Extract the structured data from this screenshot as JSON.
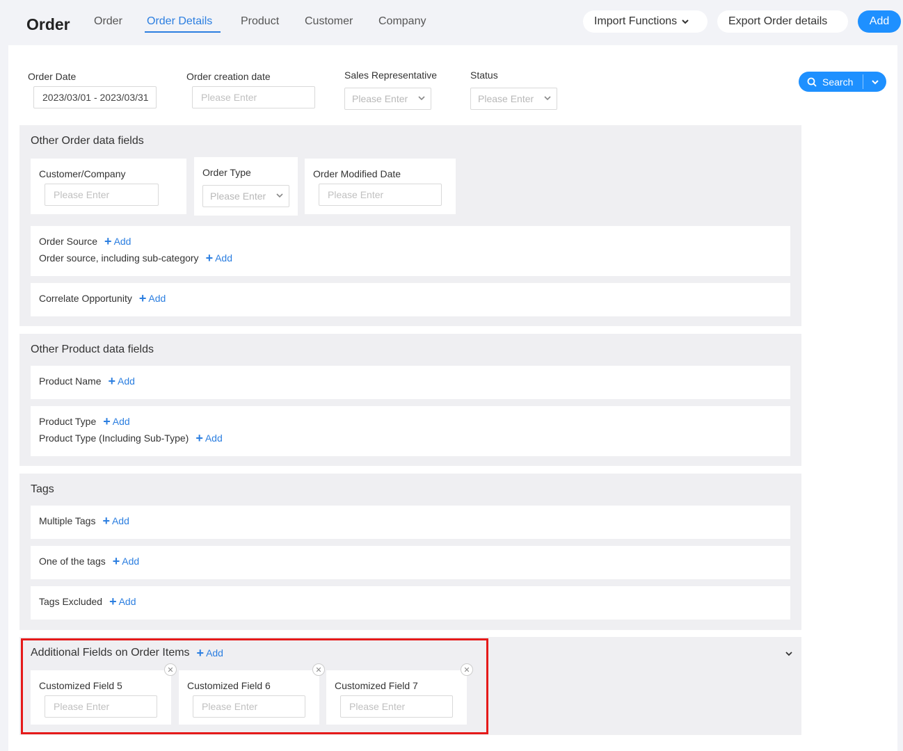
{
  "header": {
    "title": "Order",
    "tabs": [
      "Order",
      "Order Details",
      "Product",
      "Customer",
      "Company"
    ],
    "active_tab": "Order Details",
    "import_label": "Import Functions",
    "export_label": "Export Order details",
    "add_label": "Add"
  },
  "filters": {
    "order_date": {
      "label": "Order Date",
      "value": "2023/03/01 - 2023/03/31"
    },
    "order_creation_date": {
      "label": "Order creation date",
      "placeholder": "Please Enter"
    },
    "sales_rep": {
      "label": "Sales Representative",
      "placeholder": "Please Enter"
    },
    "status": {
      "label": "Status",
      "placeholder": "Please Enter"
    },
    "search_label": "Search"
  },
  "order_fields": {
    "title": "Other Order data fields",
    "customer_company": {
      "label": "Customer/Company",
      "placeholder": "Please Enter"
    },
    "order_type": {
      "label": "Order Type",
      "placeholder": "Please Enter"
    },
    "order_modified_date": {
      "label": "Order Modified Date",
      "placeholder": "Please Enter"
    },
    "order_source": "Order Source",
    "order_source_sub": "Order source, including sub-category",
    "correlate_opportunity": "Correlate Opportunity",
    "add": "Add"
  },
  "product_fields": {
    "title": "Other Product data fields",
    "product_name": "Product Name",
    "product_type": "Product Type",
    "product_type_sub": "Product Type (Including Sub-Type)",
    "add": "Add"
  },
  "tags": {
    "title": "Tags",
    "multiple": "Multiple Tags",
    "one_of": "One of the tags",
    "excluded": "Tags Excluded",
    "add": "Add"
  },
  "additional": {
    "title": "Additional Fields on Order Items",
    "add": "Add",
    "fields": [
      {
        "label": "Customized Field 5",
        "placeholder": "Please Enter"
      },
      {
        "label": "Customized Field 6",
        "placeholder": "Please Enter"
      },
      {
        "label": "Customized Field 7",
        "placeholder": "Please Enter"
      }
    ]
  },
  "colors": {
    "accent": "#1e90ff",
    "link": "#2b7ee0",
    "highlight": "#e51a1a"
  }
}
